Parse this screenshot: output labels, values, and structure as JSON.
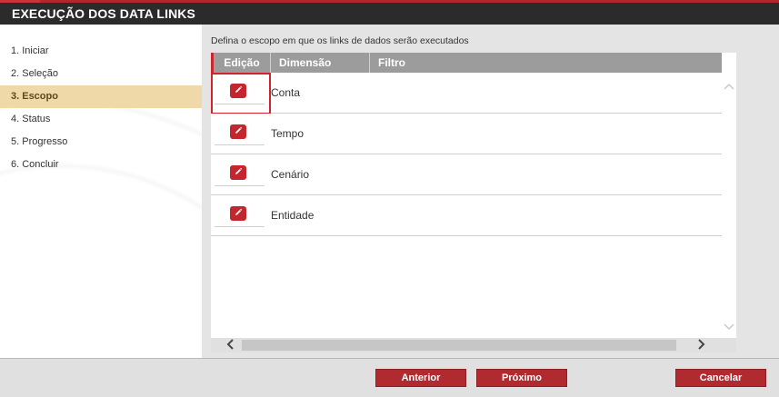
{
  "window": {
    "title": "EXECUÇÃO DOS DATA LINKS"
  },
  "steps": [
    {
      "label": "1. Iniciar",
      "active": false
    },
    {
      "label": "2. Seleção",
      "active": false
    },
    {
      "label": "3. Escopo",
      "active": true
    },
    {
      "label": "4. Status",
      "active": false
    },
    {
      "label": "5. Progresso",
      "active": false
    },
    {
      "label": "6. Concluir",
      "active": false
    }
  ],
  "main": {
    "instruction": "Defina o escopo em que os links de dados serão executados",
    "columns": {
      "edit": "Edição",
      "dimension": "Dimensão",
      "filter": "Filtro"
    },
    "rows": [
      {
        "dimension": "Conta",
        "filter": "",
        "selected": true
      },
      {
        "dimension": "Tempo",
        "filter": ""
      },
      {
        "dimension": "Cenário",
        "filter": ""
      },
      {
        "dimension": "Entidade",
        "filter": ""
      }
    ]
  },
  "footer": {
    "previous": "Anterior",
    "next": "Próximo",
    "cancel": "Cancelar"
  },
  "icons": {
    "edit": "pencil-icon",
    "scroll_up": "chevron-up-icon",
    "scroll_down": "chevron-down-icon",
    "scroll_left": "chevron-left-icon",
    "scroll_right": "chevron-right-icon"
  },
  "colors": {
    "accent": "#b02a30",
    "active_step": "#f0d9a8",
    "header": "#2b2b2b"
  }
}
